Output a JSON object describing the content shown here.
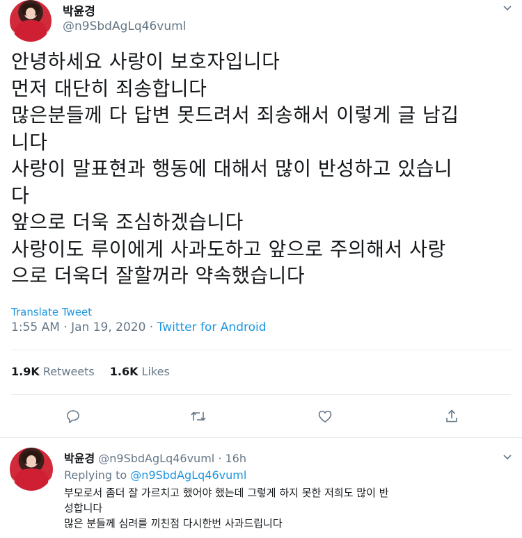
{
  "tweet": {
    "display_name": "박윤경",
    "handle": "@n9SbdAgLq46vuml",
    "body_lines": [
      "안녕하세요 사랑이 보호자입니다",
      "먼저 대단히 죄송합니다",
      "많은분들께 다 답변 못드려서 죄송해서 이렇게 글 남깁",
      "니다",
      "사랑이 말표현과 행동에 대해서 많이 반성하고 있습니",
      "다",
      "앞으로 더욱 조심하겠습니다",
      "사랑이도 루이에게 사과도하고 앞으로 주의해서 사랑",
      "으로 더욱더 잘할꺼라 약속했습니다"
    ],
    "translate_label": "Translate Tweet",
    "timestamp": "1:55 AM · Jan 19, 2020 · ",
    "source": "Twitter for Android",
    "retweets_count": "1.9K",
    "retweets_label": "Retweets",
    "likes_count": "1.6K",
    "likes_label": "Likes",
    "actions": [
      "reply-icon",
      "retweet-icon",
      "like-icon",
      "share-icon"
    ]
  },
  "reply": {
    "display_name": "박윤경",
    "handle_time": "@n9SbdAgLq46vuml · 16h",
    "replying_to_label": "Replying to",
    "replying_to_handle": "@n9SbdAgLq46vuml",
    "body_lines": [
      "부모로서 좀더 잘 가르치고 했어야 했는데 그렇게 하지 못한 저희도 많이 반",
      "성합니다",
      "많은 분들께 심려를 끼친점 다시한번 사과드립니다"
    ]
  },
  "colors": {
    "link": "#1b95e0",
    "secondary_text": "#657786",
    "primary_text": "#14171a",
    "divider": "#e6ecf0"
  }
}
